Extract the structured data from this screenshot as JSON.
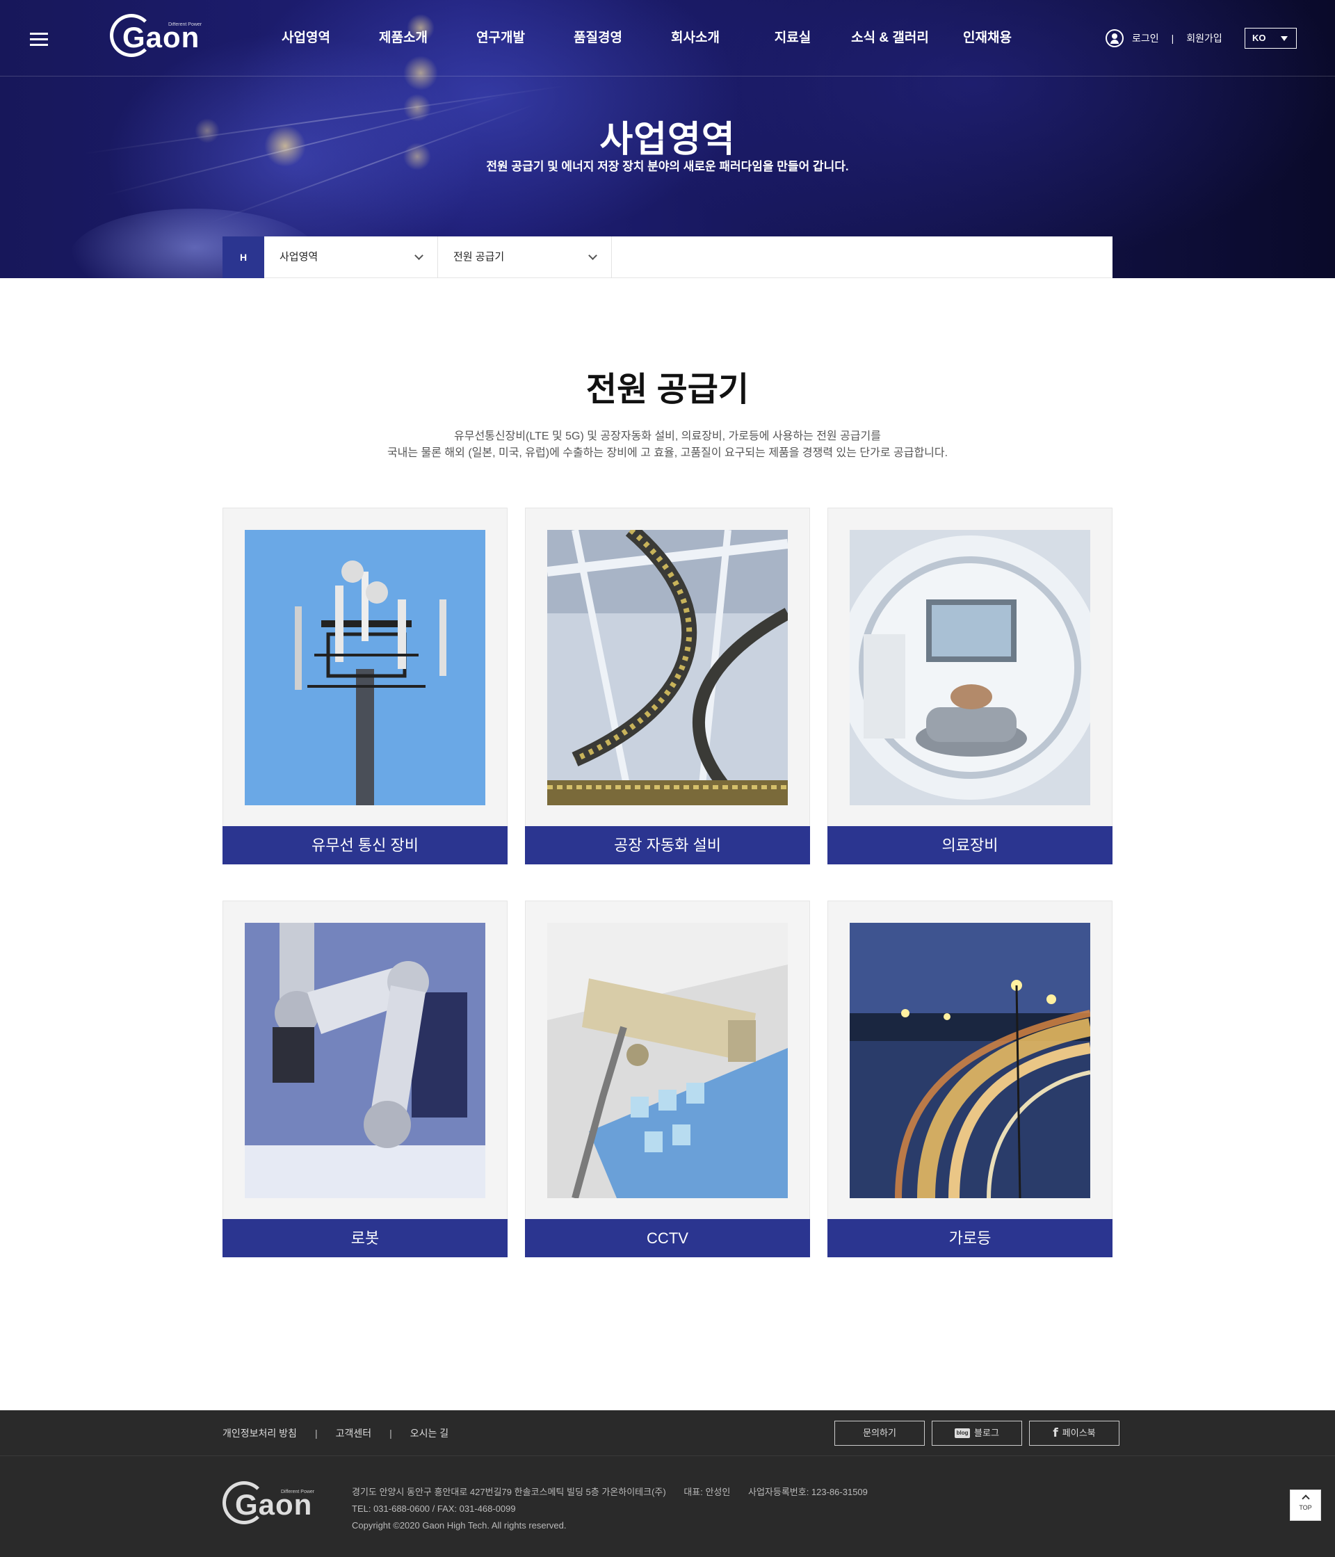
{
  "header": {
    "logo_text": "Gaon",
    "logo_tagline": "Different Power",
    "nav": [
      "사업영역",
      "제품소개",
      "연구개발",
      "품질경영",
      "회사소개",
      "지료실",
      "소식 & 갤러리",
      "인재채용"
    ],
    "login": "로그인",
    "separator": "|",
    "signup": "회원가입",
    "language": "KO"
  },
  "hero": {
    "title": "사업영역",
    "subtitle": "전원 공급기 및 에너지 저장 장치 분야의 새로운 패러다임을 만들어 갑니다."
  },
  "breadcrumb": {
    "home": "H",
    "level1": "사업영역",
    "level2": "전원 공급기"
  },
  "section": {
    "title": "전원 공급기",
    "desc_line1": "유무선통신장비(LTE 및 5G) 및 공장자동화 설비, 의료장비, 가로등에 사용하는 전원 공급기를",
    "desc_line2": "국내는 물론 해외 (일본, 미국, 유럽)에 수출하는 장비에 고 효율, 고품질이 요구되는 제품을 경쟁력 있는 단가로 공급합니다."
  },
  "cards": [
    {
      "label": "유무선 통신 장비",
      "image": "cell-tower-photo"
    },
    {
      "label": "공장 자동화 설비",
      "image": "factory-conveyor-photo"
    },
    {
      "label": "의료장비",
      "image": "mri-scanner-photo"
    },
    {
      "label": "로봇",
      "image": "robot-arm-photo"
    },
    {
      "label": "CCTV",
      "image": "cctv-camera-photo"
    },
    {
      "label": "가로등",
      "image": "street-lights-photo"
    }
  ],
  "footer": {
    "links": [
      "개인정보처리 방침",
      "고객센터",
      "오시는 길"
    ],
    "link_separator": "|",
    "buttons": {
      "inquiry": "문의하기",
      "blog": "블로그",
      "facebook": "페이스북"
    },
    "blog_icon_text": "blog",
    "facebook_icon_text": "f",
    "address": "경기도 안양시 동안구 흥안대로 427번길79 한솔코스메틱 빌딩 5층 가온하이테크(주)",
    "ceo": "대표: 안성인",
    "biz_no": "사업자등록번호: 123-86-31509",
    "contact": "TEL: 031-688-0600 / FAX: 031-468-0099",
    "copyright": "Copyright ©2020 Gaon High Tech. All rights reserved."
  },
  "top_button": "TOP",
  "colors": {
    "brand": "#2b3590",
    "footer_bg": "#2a2a2a",
    "hero_bg": "#17175a"
  }
}
